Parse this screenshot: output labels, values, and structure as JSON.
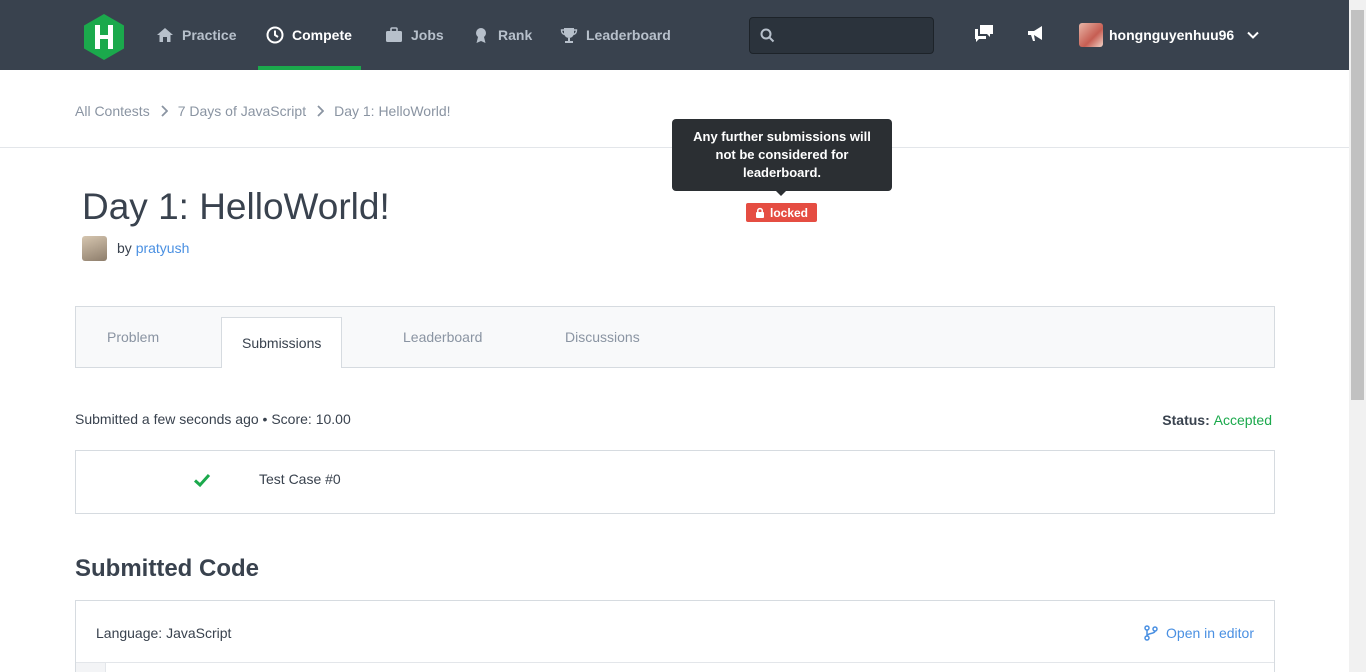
{
  "nav": {
    "items": [
      {
        "label": "Practice",
        "icon": "home-icon"
      },
      {
        "label": "Compete",
        "icon": "clock-icon"
      },
      {
        "label": "Jobs",
        "icon": "briefcase-icon"
      },
      {
        "label": "Rank",
        "icon": "medal-icon"
      },
      {
        "label": "Leaderboard",
        "icon": "trophy-icon"
      }
    ],
    "active": "Compete",
    "search_placeholder": "",
    "username": "hongnguyenhuu96"
  },
  "breadcrumb": [
    "All Contests",
    "7 Days of JavaScript",
    "Day 1: HelloWorld!"
  ],
  "tooltip": "Any further submissions will not be considered for leaderboard.",
  "locked_label": "locked",
  "challenge": {
    "title": "Day 1: HelloWorld!",
    "by": "by",
    "author": "pratyush"
  },
  "tabs": [
    "Problem",
    "Submissions",
    "Leaderboard",
    "Discussions"
  ],
  "active_tab": "Submissions",
  "submission": {
    "info": "Submitted a few seconds ago • Score: 10.00",
    "status_label": "Status:",
    "status_value": "Accepted"
  },
  "test_cases": [
    {
      "label": "Test Case #0",
      "passed": true
    }
  ],
  "code": {
    "heading": "Submitted Code",
    "language": "Language: JavaScript",
    "open_editor": "Open in editor"
  },
  "colors": {
    "nav_bg": "#39424e",
    "accent_green": "#1ba94c",
    "link_blue": "#4a90e2",
    "locked_red": "#e54d42"
  }
}
